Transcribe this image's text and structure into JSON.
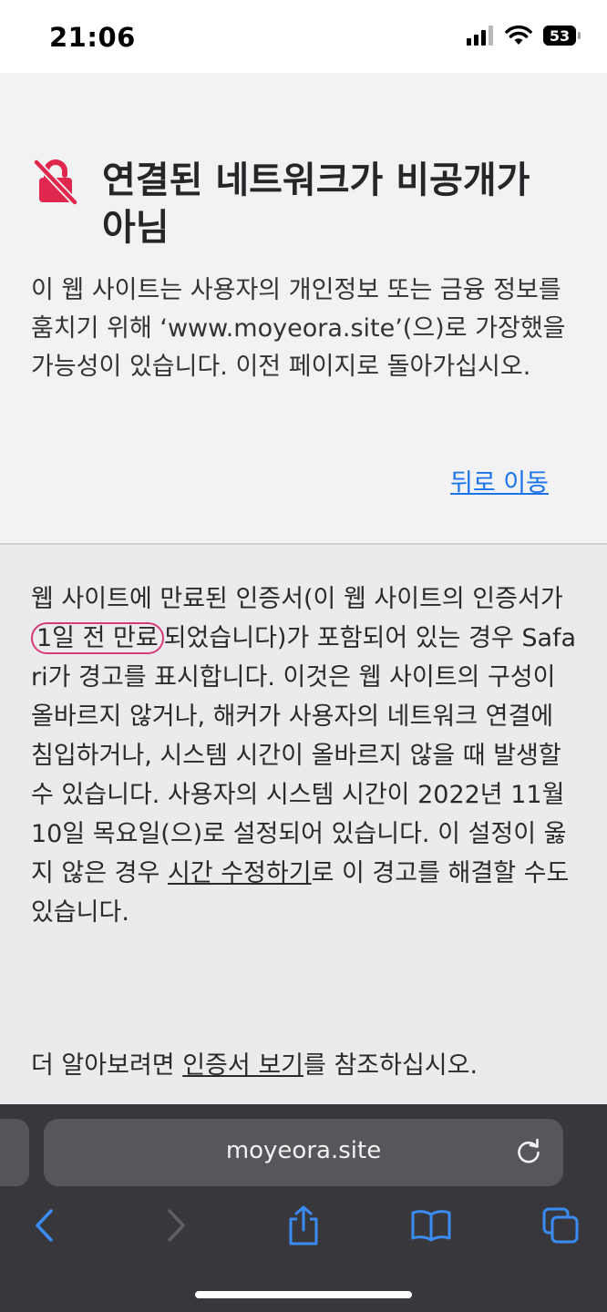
{
  "status_bar": {
    "time": "21:06",
    "battery": "53"
  },
  "warning": {
    "title": "연결된 네트워크가 비공개가 아님",
    "description": "이 웹 사이트는 사용자의 개인정보 또는 금융 정보를 훔치기 위해 ‘www.moyeora.site’(으)로 가장했을 가능성이 있습니다. 이전 페이지로 돌아가십시오.",
    "back_link": "뒤로 이동"
  },
  "details": {
    "part1": "웹 사이트에 만료된 인증서(이 웹 사이트의 인증서가 ",
    "expired_highlight": "1일 전 만료",
    "part2": "되었습니다)가 포함되어 있는 경우 Safari가 경고를 표시합니다. 이것은 웹 사이트의 구성이 올바르지 않거나, 해커가 사용자의 네트워크 연결에 침입하거나, 시스템 시간이 올바르지 않을 때 발생할 수 있습니다. 사용자의 시스템 시간이 2022년 11월 10일 목요일(으)로 설정되어 있습니다. 이 설정이 옳지 않은 경우 ",
    "fix_time_link": "시간 수정하기",
    "part3": "로 이 경고를 해결할 수도 있습니다.",
    "more_prefix": "더 알아보려면 ",
    "view_cert_link": "인증서 보기",
    "more_suffix": "를 참조하십시오."
  },
  "toolbar": {
    "address": "moyeora.site"
  },
  "icons": {
    "warning": "broken-lock-icon",
    "reload": "reload-icon",
    "back": "chevron-left-icon",
    "forward": "chevron-right-icon",
    "share": "share-icon",
    "bookmarks": "book-icon",
    "tabs": "tabs-icon"
  },
  "colors": {
    "warning_red": "#e0284f",
    "link_blue": "#1a73e8",
    "toolbar_icon_blue": "#3b8cf2",
    "highlight_pink": "#d63a78"
  }
}
